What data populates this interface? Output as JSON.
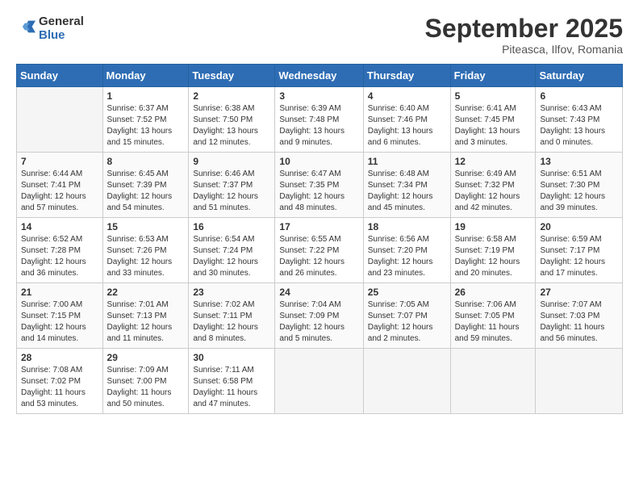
{
  "logo": {
    "general": "General",
    "blue": "Blue"
  },
  "title": "September 2025",
  "location": "Piteasca, Ilfov, Romania",
  "days_of_week": [
    "Sunday",
    "Monday",
    "Tuesday",
    "Wednesday",
    "Thursday",
    "Friday",
    "Saturday"
  ],
  "weeks": [
    [
      {
        "day": "",
        "info": ""
      },
      {
        "day": "1",
        "info": "Sunrise: 6:37 AM\nSunset: 7:52 PM\nDaylight: 13 hours\nand 15 minutes."
      },
      {
        "day": "2",
        "info": "Sunrise: 6:38 AM\nSunset: 7:50 PM\nDaylight: 13 hours\nand 12 minutes."
      },
      {
        "day": "3",
        "info": "Sunrise: 6:39 AM\nSunset: 7:48 PM\nDaylight: 13 hours\nand 9 minutes."
      },
      {
        "day": "4",
        "info": "Sunrise: 6:40 AM\nSunset: 7:46 PM\nDaylight: 13 hours\nand 6 minutes."
      },
      {
        "day": "5",
        "info": "Sunrise: 6:41 AM\nSunset: 7:45 PM\nDaylight: 13 hours\nand 3 minutes."
      },
      {
        "day": "6",
        "info": "Sunrise: 6:43 AM\nSunset: 7:43 PM\nDaylight: 13 hours\nand 0 minutes."
      }
    ],
    [
      {
        "day": "7",
        "info": "Sunrise: 6:44 AM\nSunset: 7:41 PM\nDaylight: 12 hours\nand 57 minutes."
      },
      {
        "day": "8",
        "info": "Sunrise: 6:45 AM\nSunset: 7:39 PM\nDaylight: 12 hours\nand 54 minutes."
      },
      {
        "day": "9",
        "info": "Sunrise: 6:46 AM\nSunset: 7:37 PM\nDaylight: 12 hours\nand 51 minutes."
      },
      {
        "day": "10",
        "info": "Sunrise: 6:47 AM\nSunset: 7:35 PM\nDaylight: 12 hours\nand 48 minutes."
      },
      {
        "day": "11",
        "info": "Sunrise: 6:48 AM\nSunset: 7:34 PM\nDaylight: 12 hours\nand 45 minutes."
      },
      {
        "day": "12",
        "info": "Sunrise: 6:49 AM\nSunset: 7:32 PM\nDaylight: 12 hours\nand 42 minutes."
      },
      {
        "day": "13",
        "info": "Sunrise: 6:51 AM\nSunset: 7:30 PM\nDaylight: 12 hours\nand 39 minutes."
      }
    ],
    [
      {
        "day": "14",
        "info": "Sunrise: 6:52 AM\nSunset: 7:28 PM\nDaylight: 12 hours\nand 36 minutes."
      },
      {
        "day": "15",
        "info": "Sunrise: 6:53 AM\nSunset: 7:26 PM\nDaylight: 12 hours\nand 33 minutes."
      },
      {
        "day": "16",
        "info": "Sunrise: 6:54 AM\nSunset: 7:24 PM\nDaylight: 12 hours\nand 30 minutes."
      },
      {
        "day": "17",
        "info": "Sunrise: 6:55 AM\nSunset: 7:22 PM\nDaylight: 12 hours\nand 26 minutes."
      },
      {
        "day": "18",
        "info": "Sunrise: 6:56 AM\nSunset: 7:20 PM\nDaylight: 12 hours\nand 23 minutes."
      },
      {
        "day": "19",
        "info": "Sunrise: 6:58 AM\nSunset: 7:19 PM\nDaylight: 12 hours\nand 20 minutes."
      },
      {
        "day": "20",
        "info": "Sunrise: 6:59 AM\nSunset: 7:17 PM\nDaylight: 12 hours\nand 17 minutes."
      }
    ],
    [
      {
        "day": "21",
        "info": "Sunrise: 7:00 AM\nSunset: 7:15 PM\nDaylight: 12 hours\nand 14 minutes."
      },
      {
        "day": "22",
        "info": "Sunrise: 7:01 AM\nSunset: 7:13 PM\nDaylight: 12 hours\nand 11 minutes."
      },
      {
        "day": "23",
        "info": "Sunrise: 7:02 AM\nSunset: 7:11 PM\nDaylight: 12 hours\nand 8 minutes."
      },
      {
        "day": "24",
        "info": "Sunrise: 7:04 AM\nSunset: 7:09 PM\nDaylight: 12 hours\nand 5 minutes."
      },
      {
        "day": "25",
        "info": "Sunrise: 7:05 AM\nSunset: 7:07 PM\nDaylight: 12 hours\nand 2 minutes."
      },
      {
        "day": "26",
        "info": "Sunrise: 7:06 AM\nSunset: 7:05 PM\nDaylight: 11 hours\nand 59 minutes."
      },
      {
        "day": "27",
        "info": "Sunrise: 7:07 AM\nSunset: 7:03 PM\nDaylight: 11 hours\nand 56 minutes."
      }
    ],
    [
      {
        "day": "28",
        "info": "Sunrise: 7:08 AM\nSunset: 7:02 PM\nDaylight: 11 hours\nand 53 minutes."
      },
      {
        "day": "29",
        "info": "Sunrise: 7:09 AM\nSunset: 7:00 PM\nDaylight: 11 hours\nand 50 minutes."
      },
      {
        "day": "30",
        "info": "Sunrise: 7:11 AM\nSunset: 6:58 PM\nDaylight: 11 hours\nand 47 minutes."
      },
      {
        "day": "",
        "info": ""
      },
      {
        "day": "",
        "info": ""
      },
      {
        "day": "",
        "info": ""
      },
      {
        "day": "",
        "info": ""
      }
    ]
  ]
}
